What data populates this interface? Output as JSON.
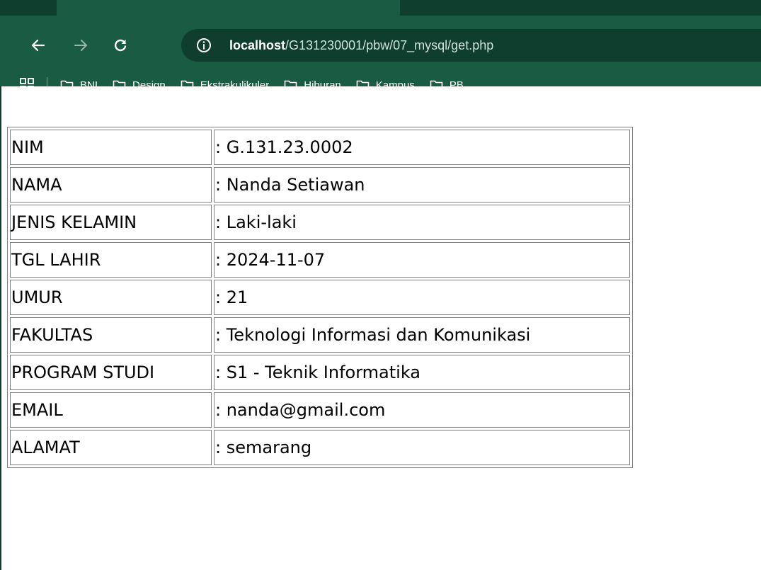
{
  "browser": {
    "url_host": "localhost",
    "url_path": "/G131230001/pbw/07_mysql/get.php",
    "bookmarks": [
      "BNI",
      "Design",
      "Ekstrakulikuler",
      "Hiburan",
      "Kampus",
      "PB"
    ],
    "colors": {
      "toolbar": "#1a5c43",
      "frame": "#0f3d2e"
    }
  },
  "table": {
    "rows": [
      {
        "label": "NIM",
        "value": ": G.131.23.0002"
      },
      {
        "label": "NAMA",
        "value": ": Nanda Setiawan"
      },
      {
        "label": "JENIS KELAMIN",
        "value": ": Laki-laki"
      },
      {
        "label": "TGL LAHIR",
        "value": ": 2024-11-07"
      },
      {
        "label": "UMUR",
        "value": ": 21"
      },
      {
        "label": "FAKULTAS",
        "value": ": Teknologi Informasi dan Komunikasi"
      },
      {
        "label": "PROGRAM STUDI",
        "value": ": S1 - Teknik Informatika"
      },
      {
        "label": "EMAIL",
        "value": ": nanda@gmail.com"
      },
      {
        "label": "ALAMAT",
        "value": ": semarang"
      }
    ]
  }
}
